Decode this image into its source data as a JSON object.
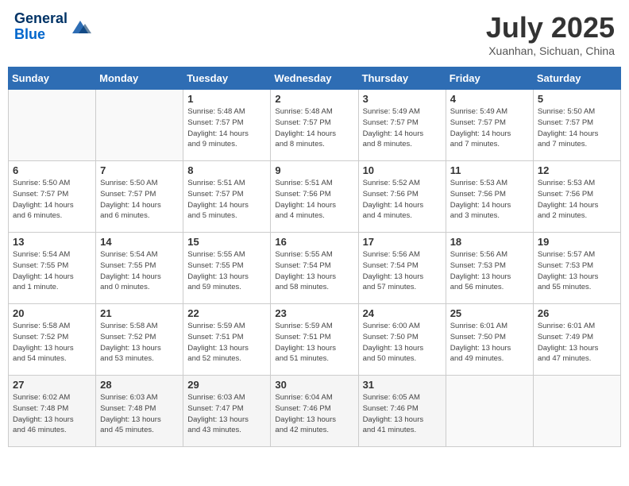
{
  "header": {
    "logo_line1": "General",
    "logo_line2": "Blue",
    "month_title": "July 2025",
    "location": "Xuanhan, Sichuan, China"
  },
  "weekdays": [
    "Sunday",
    "Monday",
    "Tuesday",
    "Wednesday",
    "Thursday",
    "Friday",
    "Saturday"
  ],
  "weeks": [
    [
      {
        "day": "",
        "info": ""
      },
      {
        "day": "",
        "info": ""
      },
      {
        "day": "1",
        "info": "Sunrise: 5:48 AM\nSunset: 7:57 PM\nDaylight: 14 hours\nand 9 minutes."
      },
      {
        "day": "2",
        "info": "Sunrise: 5:48 AM\nSunset: 7:57 PM\nDaylight: 14 hours\nand 8 minutes."
      },
      {
        "day": "3",
        "info": "Sunrise: 5:49 AM\nSunset: 7:57 PM\nDaylight: 14 hours\nand 8 minutes."
      },
      {
        "day": "4",
        "info": "Sunrise: 5:49 AM\nSunset: 7:57 PM\nDaylight: 14 hours\nand 7 minutes."
      },
      {
        "day": "5",
        "info": "Sunrise: 5:50 AM\nSunset: 7:57 PM\nDaylight: 14 hours\nand 7 minutes."
      }
    ],
    [
      {
        "day": "6",
        "info": "Sunrise: 5:50 AM\nSunset: 7:57 PM\nDaylight: 14 hours\nand 6 minutes."
      },
      {
        "day": "7",
        "info": "Sunrise: 5:50 AM\nSunset: 7:57 PM\nDaylight: 14 hours\nand 6 minutes."
      },
      {
        "day": "8",
        "info": "Sunrise: 5:51 AM\nSunset: 7:57 PM\nDaylight: 14 hours\nand 5 minutes."
      },
      {
        "day": "9",
        "info": "Sunrise: 5:51 AM\nSunset: 7:56 PM\nDaylight: 14 hours\nand 4 minutes."
      },
      {
        "day": "10",
        "info": "Sunrise: 5:52 AM\nSunset: 7:56 PM\nDaylight: 14 hours\nand 4 minutes."
      },
      {
        "day": "11",
        "info": "Sunrise: 5:53 AM\nSunset: 7:56 PM\nDaylight: 14 hours\nand 3 minutes."
      },
      {
        "day": "12",
        "info": "Sunrise: 5:53 AM\nSunset: 7:56 PM\nDaylight: 14 hours\nand 2 minutes."
      }
    ],
    [
      {
        "day": "13",
        "info": "Sunrise: 5:54 AM\nSunset: 7:55 PM\nDaylight: 14 hours\nand 1 minute."
      },
      {
        "day": "14",
        "info": "Sunrise: 5:54 AM\nSunset: 7:55 PM\nDaylight: 14 hours\nand 0 minutes."
      },
      {
        "day": "15",
        "info": "Sunrise: 5:55 AM\nSunset: 7:55 PM\nDaylight: 13 hours\nand 59 minutes."
      },
      {
        "day": "16",
        "info": "Sunrise: 5:55 AM\nSunset: 7:54 PM\nDaylight: 13 hours\nand 58 minutes."
      },
      {
        "day": "17",
        "info": "Sunrise: 5:56 AM\nSunset: 7:54 PM\nDaylight: 13 hours\nand 57 minutes."
      },
      {
        "day": "18",
        "info": "Sunrise: 5:56 AM\nSunset: 7:53 PM\nDaylight: 13 hours\nand 56 minutes."
      },
      {
        "day": "19",
        "info": "Sunrise: 5:57 AM\nSunset: 7:53 PM\nDaylight: 13 hours\nand 55 minutes."
      }
    ],
    [
      {
        "day": "20",
        "info": "Sunrise: 5:58 AM\nSunset: 7:52 PM\nDaylight: 13 hours\nand 54 minutes."
      },
      {
        "day": "21",
        "info": "Sunrise: 5:58 AM\nSunset: 7:52 PM\nDaylight: 13 hours\nand 53 minutes."
      },
      {
        "day": "22",
        "info": "Sunrise: 5:59 AM\nSunset: 7:51 PM\nDaylight: 13 hours\nand 52 minutes."
      },
      {
        "day": "23",
        "info": "Sunrise: 5:59 AM\nSunset: 7:51 PM\nDaylight: 13 hours\nand 51 minutes."
      },
      {
        "day": "24",
        "info": "Sunrise: 6:00 AM\nSunset: 7:50 PM\nDaylight: 13 hours\nand 50 minutes."
      },
      {
        "day": "25",
        "info": "Sunrise: 6:01 AM\nSunset: 7:50 PM\nDaylight: 13 hours\nand 49 minutes."
      },
      {
        "day": "26",
        "info": "Sunrise: 6:01 AM\nSunset: 7:49 PM\nDaylight: 13 hours\nand 47 minutes."
      }
    ],
    [
      {
        "day": "27",
        "info": "Sunrise: 6:02 AM\nSunset: 7:48 PM\nDaylight: 13 hours\nand 46 minutes."
      },
      {
        "day": "28",
        "info": "Sunrise: 6:03 AM\nSunset: 7:48 PM\nDaylight: 13 hours\nand 45 minutes."
      },
      {
        "day": "29",
        "info": "Sunrise: 6:03 AM\nSunset: 7:47 PM\nDaylight: 13 hours\nand 43 minutes."
      },
      {
        "day": "30",
        "info": "Sunrise: 6:04 AM\nSunset: 7:46 PM\nDaylight: 13 hours\nand 42 minutes."
      },
      {
        "day": "31",
        "info": "Sunrise: 6:05 AM\nSunset: 7:46 PM\nDaylight: 13 hours\nand 41 minutes."
      },
      {
        "day": "",
        "info": ""
      },
      {
        "day": "",
        "info": ""
      }
    ]
  ]
}
